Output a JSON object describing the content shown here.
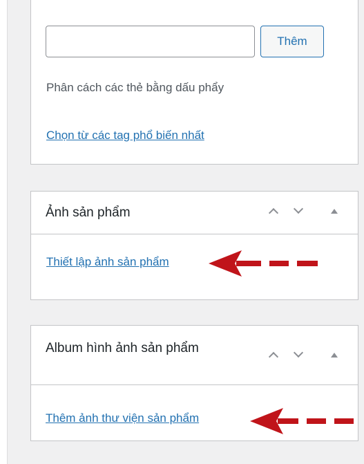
{
  "tags_box": {
    "input_value": "",
    "add_button_label": "Thêm",
    "helper_text": "Phân cách các thẻ bằng dấu phẩy",
    "popular_tags_link": "Chọn từ các tag phổ biến nhất"
  },
  "product_image_box": {
    "title": "Ảnh sản phẩm",
    "set_image_link": "Thiết lập ảnh sản phẩm",
    "controls": [
      "chevron-up-icon",
      "chevron-down-icon",
      "toggle-panel-icon"
    ]
  },
  "gallery_box": {
    "title": "Album hình ảnh sản phẩm",
    "add_gallery_link": "Thêm ảnh thư viện sản phẩm",
    "controls": [
      "chevron-up-icon",
      "chevron-down-icon",
      "toggle-panel-icon"
    ]
  },
  "annotation": {
    "arrow_color": "#c0141a"
  }
}
